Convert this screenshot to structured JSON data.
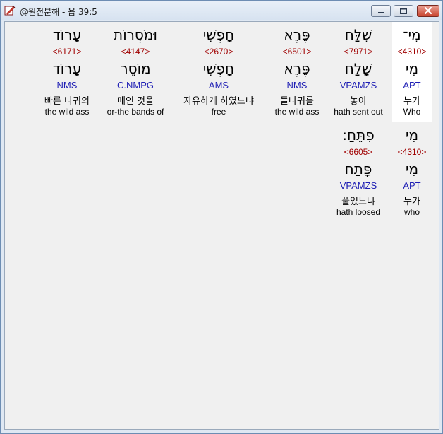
{
  "window": {
    "title": "@원전분해 - 욥 39:5"
  },
  "rows": [
    {
      "words": [
        {
          "hebrew": "עָרוֹד",
          "strong": "<6171>",
          "lemma": "עָרוֹד",
          "morph": "NMS",
          "korean": "빠른 나귀의",
          "english": "the wild ass"
        },
        {
          "hebrew": "וּמֹסְרוֹת",
          "strong": "<4147>",
          "lemma": "מוֹסֵר",
          "morph": "C.NMPG",
          "korean": "매인 것을",
          "english": "or-the bands of"
        },
        {
          "hebrew": "חָפְשִׁי",
          "strong": "<2670>",
          "lemma": "חָפְשִׁי",
          "morph": "AMS",
          "korean": "자유하게 하였느냐",
          "english": "free"
        },
        {
          "hebrew": "פֶּרֶא",
          "strong": "<6501>",
          "lemma": "פֶּרֶא",
          "morph": "NMS",
          "korean": "들나귀를",
          "english": "the wild ass"
        },
        {
          "hebrew": "שִׁלַּח",
          "strong": "<7971>",
          "lemma": "שָׁלַח",
          "morph": "VPAMZS",
          "korean": "놓아",
          "english": "hath sent out"
        },
        {
          "hebrew": "מִי־",
          "strong": "<4310>",
          "lemma": "מִי",
          "morph": "APT",
          "korean": "누가",
          "english": "Who"
        }
      ]
    },
    {
      "words": [
        {
          "hebrew": "פִתֵּחַ:",
          "strong": "<6605>",
          "lemma": "פָּתַח",
          "morph": "VPAMZS",
          "korean": "풀었느냐",
          "english": "hath loosed"
        },
        {
          "hebrew": "מִי",
          "strong": "<4310>",
          "lemma": "מִי",
          "morph": "APT",
          "korean": "누가",
          "english": "who"
        }
      ]
    }
  ]
}
